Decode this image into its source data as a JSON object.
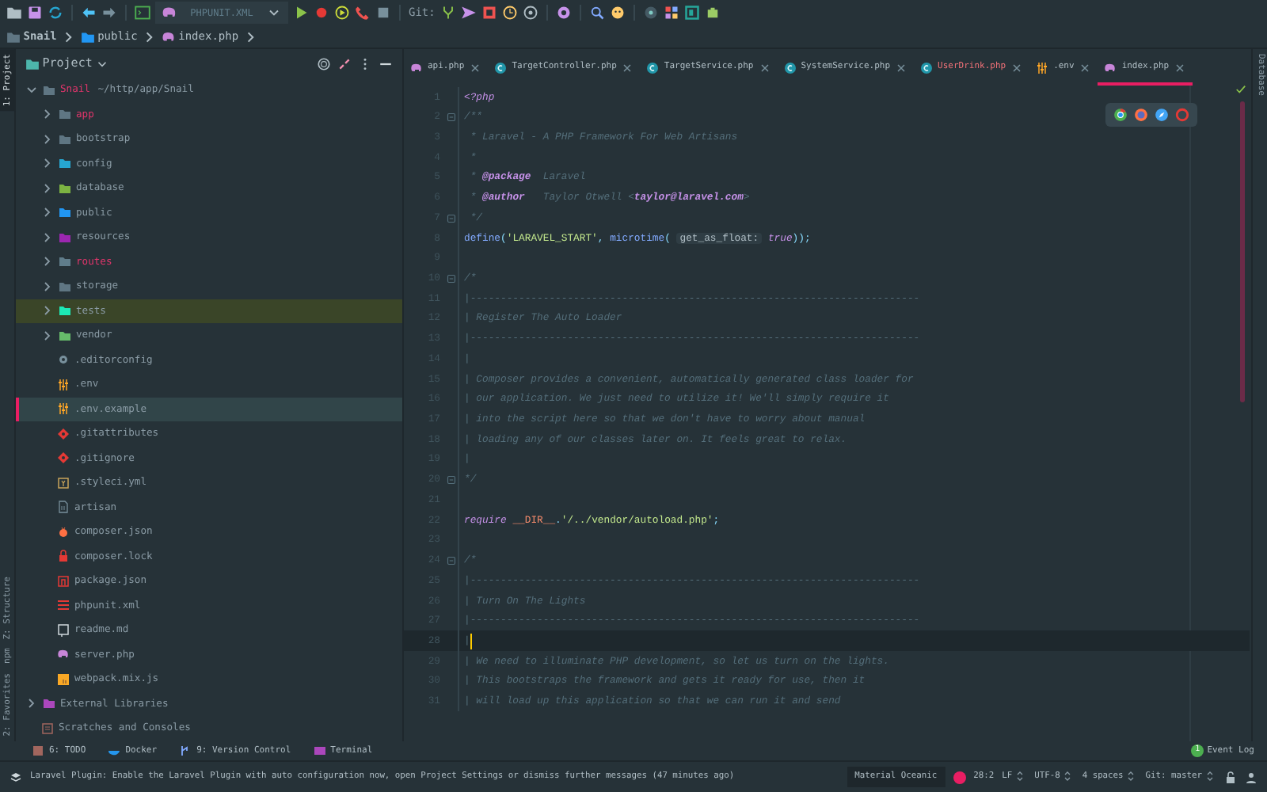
{
  "toolbar": {
    "run_config": "PHPUNIT.XML",
    "git_label": "Git:"
  },
  "breadcrumb": [
    {
      "label": "Snail",
      "kind": "folder"
    },
    {
      "label": "public",
      "kind": "web"
    },
    {
      "label": "index.php",
      "kind": "php"
    }
  ],
  "side_tools_left": [
    {
      "label": "1: Project",
      "selected": true
    },
    {
      "label": "Z: Structure",
      "selected": false
    },
    {
      "label": "npm",
      "selected": false
    },
    {
      "label": "2: Favorites",
      "selected": false
    }
  ],
  "side_tools_right": [
    {
      "label": "Database",
      "selected": false
    }
  ],
  "project": {
    "title": "Project",
    "tree": [
      {
        "name": "Snail",
        "path": "~/http/app/Snail",
        "kind": "folder",
        "color": "#e0356b",
        "expanded": true,
        "selected": false,
        "highlighted": false,
        "children": [
          {
            "name": "app",
            "kind": "folder",
            "color": "#e0356b",
            "expanded": false,
            "selected": false,
            "highlighted": false
          },
          {
            "name": "bootstrap",
            "kind": "folder",
            "color": "#8a9ba5",
            "expanded": false,
            "selected": false,
            "highlighted": false
          },
          {
            "name": "config",
            "kind": "config",
            "color": "#8a9ba5",
            "expanded": false,
            "selected": false,
            "highlighted": false
          },
          {
            "name": "database",
            "kind": "database",
            "color": "#8a9ba5",
            "expanded": false,
            "selected": false,
            "highlighted": false
          },
          {
            "name": "public",
            "kind": "web",
            "color": "#8a9ba5",
            "expanded": false,
            "selected": false,
            "highlighted": false
          },
          {
            "name": "resources",
            "kind": "resources",
            "color": "#8a9ba5",
            "expanded": false,
            "selected": false,
            "highlighted": false
          },
          {
            "name": "routes",
            "kind": "routes",
            "color": "#e0356b",
            "expanded": false,
            "selected": false,
            "highlighted": false
          },
          {
            "name": "storage",
            "kind": "folder",
            "color": "#8a9ba5",
            "expanded": false,
            "selected": false,
            "highlighted": false
          },
          {
            "name": "tests",
            "kind": "tests",
            "color": "#8a9ba5",
            "expanded": false,
            "selected": false,
            "highlighted": true
          },
          {
            "name": "vendor",
            "kind": "vendor",
            "color": "#8a9ba5",
            "expanded": false,
            "selected": false,
            "highlighted": false
          },
          {
            "name": ".editorconfig",
            "kind": "settings",
            "color": "#8a9ba5",
            "selected": false,
            "highlighted": false
          },
          {
            "name": ".env",
            "kind": "env",
            "color": "#8a9ba5",
            "selected": false,
            "highlighted": false
          },
          {
            "name": ".env.example",
            "kind": "env",
            "color": "#8a9ba5",
            "selected": true,
            "highlighted": false
          },
          {
            "name": ".gitattributes",
            "kind": "git",
            "color": "#8a9ba5",
            "selected": false,
            "highlighted": false
          },
          {
            "name": ".gitignore",
            "kind": "git",
            "color": "#8a9ba5",
            "selected": false,
            "highlighted": false
          },
          {
            "name": ".styleci.yml",
            "kind": "yaml",
            "color": "#8a9ba5",
            "selected": false,
            "highlighted": false
          },
          {
            "name": "artisan",
            "kind": "script",
            "color": "#8a9ba5",
            "selected": false,
            "highlighted": false
          },
          {
            "name": "composer.json",
            "kind": "composer",
            "color": "#8a9ba5",
            "selected": false,
            "highlighted": false
          },
          {
            "name": "composer.lock",
            "kind": "lock",
            "color": "#8a9ba5",
            "selected": false,
            "highlighted": false
          },
          {
            "name": "package.json",
            "kind": "npm",
            "color": "#8a9ba5",
            "selected": false,
            "highlighted": false
          },
          {
            "name": "phpunit.xml",
            "kind": "xml",
            "color": "#8a9ba5",
            "selected": false,
            "highlighted": false
          },
          {
            "name": "readme.md",
            "kind": "markdown",
            "color": "#8a9ba5",
            "selected": false,
            "highlighted": false
          },
          {
            "name": "server.php",
            "kind": "php",
            "color": "#8a9ba5",
            "selected": false,
            "highlighted": false
          },
          {
            "name": "webpack.mix.js",
            "kind": "js",
            "color": "#8a9ba5",
            "selected": false,
            "highlighted": false
          }
        ]
      },
      {
        "name": "External Libraries",
        "kind": "library",
        "color": "#8a9ba5",
        "expanded": false,
        "selected": false,
        "highlighted": false
      },
      {
        "name": "Scratches and Consoles",
        "kind": "scratch",
        "color": "#8a9ba5",
        "selected": false,
        "highlighted": false
      }
    ]
  },
  "tabs": [
    {
      "label": "api.php",
      "kind": "php",
      "color": "#b0bec5",
      "selected": false
    },
    {
      "label": "TargetController.php",
      "kind": "class",
      "color": "#b0bec5",
      "selected": false
    },
    {
      "label": "TargetService.php",
      "kind": "class",
      "color": "#b0bec5",
      "selected": false
    },
    {
      "label": "SystemService.php",
      "kind": "class",
      "color": "#b0bec5",
      "selected": false
    },
    {
      "label": "UserDrink.php",
      "kind": "class",
      "color": "#f07178",
      "selected": false
    },
    {
      "label": ".env",
      "kind": "env",
      "color": "#b0bec5",
      "selected": false
    },
    {
      "label": "index.php",
      "kind": "php",
      "color": "#b0bec5",
      "selected": true
    }
  ],
  "editor": {
    "lines": [
      {
        "number": "1",
        "fold": false,
        "current": false,
        "tokens": [
          {
            "kind": "tag",
            "text": "<?php"
          }
        ]
      },
      {
        "number": "2",
        "fold": true,
        "current": false,
        "tokens": [
          {
            "kind": "comment",
            "text": "/**"
          }
        ]
      },
      {
        "number": "3",
        "fold": false,
        "current": false,
        "tokens": [
          {
            "kind": "comment",
            "text": " * Laravel - A PHP Framework For Web Artisans"
          }
        ]
      },
      {
        "number": "4",
        "fold": false,
        "current": false,
        "tokens": [
          {
            "kind": "comment",
            "text": " *"
          }
        ]
      },
      {
        "number": "5",
        "fold": false,
        "current": false,
        "tokens": [
          {
            "kind": "comment",
            "text": " * "
          },
          {
            "kind": "doctag",
            "text": "@package"
          },
          {
            "kind": "comment",
            "text": "  Laravel"
          }
        ]
      },
      {
        "number": "6",
        "fold": false,
        "current": false,
        "tokens": [
          {
            "kind": "comment",
            "text": " * "
          },
          {
            "kind": "doctag",
            "text": "@author"
          },
          {
            "kind": "comment",
            "text": "   Taylor Otwell <"
          },
          {
            "kind": "email",
            "text": "taylor@laravel.com"
          },
          {
            "kind": "comment",
            "text": ">"
          }
        ]
      },
      {
        "number": "7",
        "fold": true,
        "current": false,
        "tokens": [
          {
            "kind": "comment",
            "text": " */"
          }
        ]
      },
      {
        "number": "8",
        "fold": false,
        "current": false,
        "tokens": [
          {
            "kind": "function",
            "text": "define"
          },
          {
            "kind": "punct",
            "text": "("
          },
          {
            "kind": "string",
            "text": "'LARAVEL_START'"
          },
          {
            "kind": "punct",
            "text": ", "
          },
          {
            "kind": "function",
            "text": "microtime"
          },
          {
            "kind": "punct",
            "text": "( "
          },
          {
            "kind": "hint",
            "text": "get_as_float:"
          },
          {
            "kind": "keyword",
            "text": " true"
          },
          {
            "kind": "punct",
            "text": "));"
          }
        ]
      },
      {
        "number": "9",
        "fold": false,
        "current": false
      },
      {
        "number": "10",
        "fold": true,
        "current": false,
        "tokens": [
          {
            "kind": "comment",
            "text": "/*"
          }
        ]
      },
      {
        "number": "11",
        "fold": false,
        "current": false,
        "tokens": [
          {
            "kind": "comment",
            "text": "|--------------------------------------------------------------------------"
          }
        ]
      },
      {
        "number": "12",
        "fold": false,
        "current": false,
        "tokens": [
          {
            "kind": "comment",
            "text": "| Register The Auto Loader"
          }
        ]
      },
      {
        "number": "13",
        "fold": false,
        "current": false,
        "tokens": [
          {
            "kind": "comment",
            "text": "|--------------------------------------------------------------------------"
          }
        ]
      },
      {
        "number": "14",
        "fold": false,
        "current": false,
        "tokens": [
          {
            "kind": "comment",
            "text": "|"
          }
        ]
      },
      {
        "number": "15",
        "fold": false,
        "current": false,
        "tokens": [
          {
            "kind": "comment",
            "text": "| Composer provides a convenient, automatically generated class loader for"
          }
        ]
      },
      {
        "number": "16",
        "fold": false,
        "current": false,
        "tokens": [
          {
            "kind": "comment",
            "text": "| our application. We just need to utilize it! We'll simply require it"
          }
        ]
      },
      {
        "number": "17",
        "fold": false,
        "current": false,
        "tokens": [
          {
            "kind": "comment",
            "text": "| into the script here so that we don't have to worry about manual"
          }
        ]
      },
      {
        "number": "18",
        "fold": false,
        "current": false,
        "tokens": [
          {
            "kind": "comment",
            "text": "| loading any of our classes later on. It feels great to relax."
          }
        ]
      },
      {
        "number": "19",
        "fold": false,
        "current": false,
        "tokens": [
          {
            "kind": "comment",
            "text": "|"
          }
        ]
      },
      {
        "number": "20",
        "fold": true,
        "current": false,
        "tokens": [
          {
            "kind": "comment",
            "text": "*/"
          }
        ]
      },
      {
        "number": "21",
        "fold": false,
        "current": false
      },
      {
        "number": "22",
        "fold": false,
        "current": false,
        "tokens": [
          {
            "kind": "keyword",
            "text": "require "
          },
          {
            "kind": "constant",
            "text": "__DIR__"
          },
          {
            "kind": "punct",
            "text": "."
          },
          {
            "kind": "string",
            "text": "'/../vendor/autoload.php'"
          },
          {
            "kind": "punct",
            "text": ";"
          }
        ]
      },
      {
        "number": "23",
        "fold": false,
        "current": false
      },
      {
        "number": "24",
        "fold": true,
        "current": false,
        "tokens": [
          {
            "kind": "comment",
            "text": "/*"
          }
        ]
      },
      {
        "number": "25",
        "fold": false,
        "current": false,
        "tokens": [
          {
            "kind": "comment",
            "text": "|--------------------------------------------------------------------------"
          }
        ]
      },
      {
        "number": "26",
        "fold": false,
        "current": false,
        "tokens": [
          {
            "kind": "comment",
            "text": "| Turn On The Lights"
          }
        ]
      },
      {
        "number": "27",
        "fold": false,
        "current": false,
        "tokens": [
          {
            "kind": "comment",
            "text": "|--------------------------------------------------------------------------"
          }
        ]
      },
      {
        "number": "28",
        "fold": false,
        "current": true,
        "tokens": [
          {
            "kind": "comment",
            "text": "|"
          }
        ]
      },
      {
        "number": "29",
        "fold": false,
        "current": false,
        "tokens": [
          {
            "kind": "comment",
            "text": "| We need to illuminate PHP development, so let us turn on the lights."
          }
        ]
      },
      {
        "number": "30",
        "fold": false,
        "current": false,
        "tokens": [
          {
            "kind": "comment",
            "text": "| This bootstraps the framework and gets it ready for use, then it"
          }
        ]
      },
      {
        "number": "31",
        "fold": false,
        "current": false,
        "tokens": [
          {
            "kind": "comment",
            "text": "| will load up this application so that we can run it and send"
          }
        ]
      }
    ]
  },
  "tool_windows": [
    {
      "label": "6: TODO",
      "kind": "todo"
    },
    {
      "label": "Docker",
      "kind": "docker"
    },
    {
      "label": "9: Version Control",
      "kind": "vcs"
    },
    {
      "label": "Terminal",
      "kind": "terminal"
    }
  ],
  "event_log": {
    "label": "Event Log",
    "count": "1"
  },
  "status_bar": {
    "message": "Laravel Plugin: Enable the Laravel Plugin with auto configuration now, open Project Settings or dismiss further messages (47 minutes ago)",
    "theme": "Material Oceanic",
    "position": "28:2",
    "line_separator": "LF",
    "encoding": "UTF-8",
    "indent": "4 spaces",
    "branch": "Git: master"
  }
}
